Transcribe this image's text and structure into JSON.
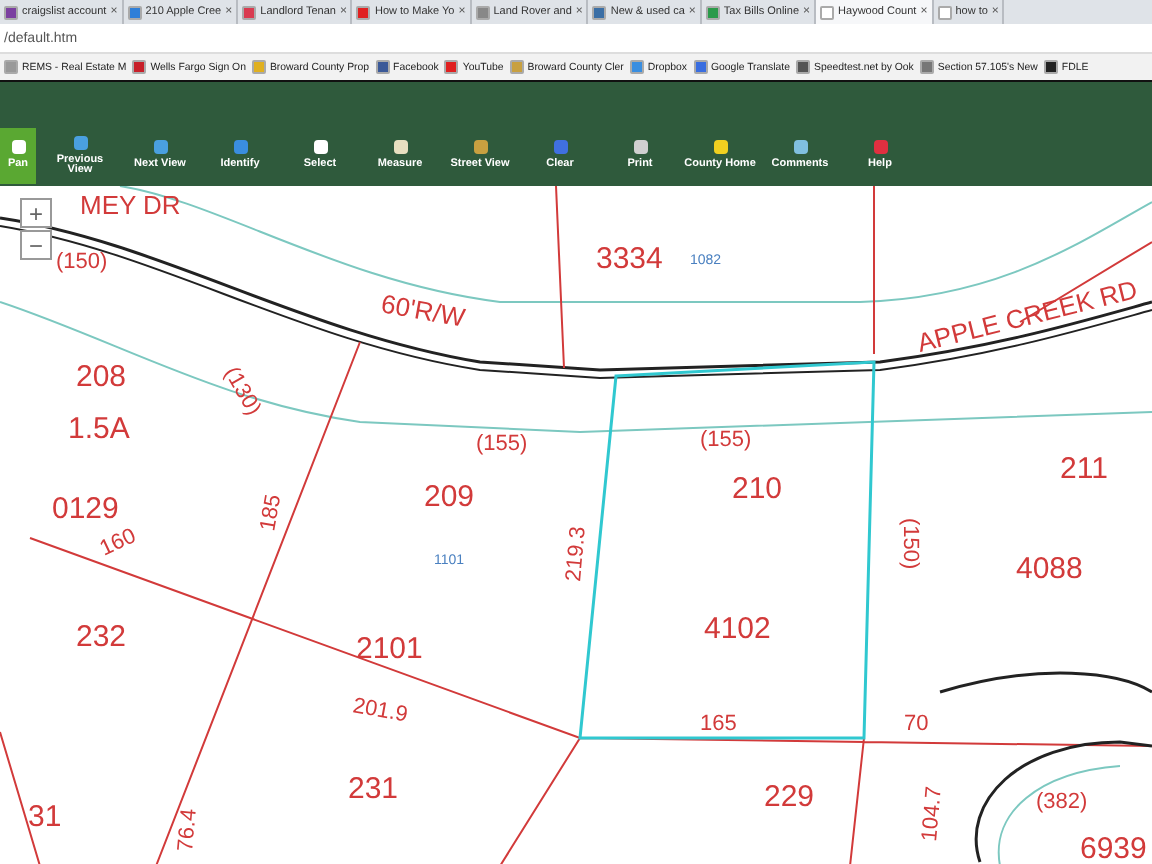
{
  "browser": {
    "tabs": [
      {
        "label": "craigslist account",
        "selected": false
      },
      {
        "label": "210 Apple Cree",
        "selected": false
      },
      {
        "label": "Landlord Tenan",
        "selected": false
      },
      {
        "label": "How to Make Yo",
        "selected": false
      },
      {
        "label": "Land Rover and",
        "selected": false
      },
      {
        "label": "New & used ca",
        "selected": false
      },
      {
        "label": "Tax Bills Online",
        "selected": false
      },
      {
        "label": "Haywood Count",
        "selected": true
      },
      {
        "label": "how to",
        "selected": false
      }
    ],
    "tab_close": [
      "×",
      "×",
      "×",
      "×",
      "×",
      "×",
      "×",
      "×",
      "×"
    ],
    "address": "/default.htm",
    "bookmarks": [
      "REMS - Real Estate M",
      "Wells Fargo Sign On",
      "Broward County Prop",
      "Facebook",
      "YouTube",
      "Broward County Cler",
      "Dropbox",
      "Google Translate",
      "Speedtest.net by Ook",
      "Section 57.105's New",
      "FDLE"
    ]
  },
  "toolbar": [
    {
      "label": "Pan",
      "selected": true
    },
    {
      "label": "Previous View",
      "selected": false
    },
    {
      "label": "Next View",
      "selected": false
    },
    {
      "label": "Identify",
      "selected": false
    },
    {
      "label": "Select",
      "selected": false
    },
    {
      "label": "Measure",
      "selected": false
    },
    {
      "label": "Street View",
      "selected": false
    },
    {
      "label": "Clear",
      "selected": false
    },
    {
      "label": "Print",
      "selected": false
    },
    {
      "label": "County Home",
      "selected": false
    },
    {
      "label": "Comments",
      "selected": false
    },
    {
      "label": "Help",
      "selected": false
    }
  ],
  "map": {
    "zoom": [
      "+",
      "−"
    ],
    "labels": [
      {
        "text": "MEY DR",
        "kind": "road"
      },
      {
        "text": "(150)",
        "kind": "dim"
      },
      {
        "text": "3334",
        "kind": "parcel"
      },
      {
        "text": "1082",
        "kind": "note"
      },
      {
        "text": "60'R/W",
        "kind": "road"
      },
      {
        "text": "208",
        "kind": "parcel"
      },
      {
        "text": "(130)",
        "kind": "dim"
      },
      {
        "text": "APPLE CREEK RD",
        "kind": "road"
      },
      {
        "text": "1.5A",
        "kind": "parcel"
      },
      {
        "text": "(155)",
        "kind": "dim"
      },
      {
        "text": "(155)",
        "kind": "dim"
      },
      {
        "text": "209",
        "kind": "parcel"
      },
      {
        "text": "210",
        "kind": "parcel"
      },
      {
        "text": "211",
        "kind": "parcel"
      },
      {
        "text": "0129",
        "kind": "parcel"
      },
      {
        "text": "185",
        "kind": "dim"
      },
      {
        "text": "(150)",
        "kind": "dim"
      },
      {
        "text": "4088",
        "kind": "parcel"
      },
      {
        "text": "160",
        "kind": "dim"
      },
      {
        "text": "1101",
        "kind": "note"
      },
      {
        "text": "219.3",
        "kind": "dim"
      },
      {
        "text": "4102",
        "kind": "parcel"
      },
      {
        "text": "232",
        "kind": "parcel"
      },
      {
        "text": "2101",
        "kind": "parcel"
      },
      {
        "text": "201.9",
        "kind": "dim"
      },
      {
        "text": "165",
        "kind": "dim"
      },
      {
        "text": "70",
        "kind": "dim"
      },
      {
        "text": "231",
        "kind": "parcel"
      },
      {
        "text": "229",
        "kind": "parcel"
      },
      {
        "text": "31",
        "kind": "parcel"
      },
      {
        "text": "76.4",
        "kind": "dim"
      },
      {
        "text": "104.7",
        "kind": "dim"
      },
      {
        "text": "(382)",
        "kind": "dim"
      },
      {
        "text": "6939",
        "kind": "parcel"
      }
    ]
  }
}
